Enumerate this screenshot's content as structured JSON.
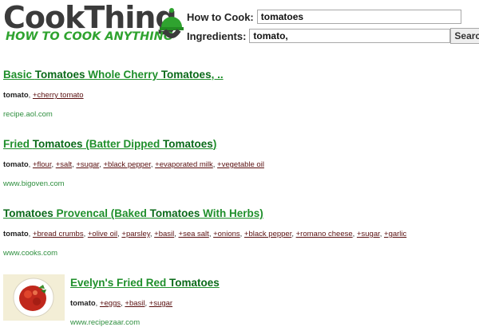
{
  "logo": {
    "name": "CookThing",
    "tagline": "HOW TO COOK ANYTHING"
  },
  "search": {
    "how_to_cook_label": "How to Cook:",
    "how_to_cook_value": "tomatoes",
    "ingredients_label": "Ingredients:",
    "ingredients_value": "tomato,",
    "button_label": "Search"
  },
  "colors": {
    "title_green": "#1f8f2b",
    "logo_green": "#2fa32f",
    "ingredient_link": "#5a1010"
  },
  "results": [
    {
      "title_parts": [
        "Basic ",
        "Tomatoes",
        " Whole Cherry ",
        "Tomatoes",
        ", .."
      ],
      "base": "tomato",
      "ingredients": [
        "+cherry tomato"
      ],
      "source": "recipe.aol.com"
    },
    {
      "title_parts": [
        "Fried ",
        "Tomatoes",
        " (Batter Dipped ",
        "Tomatoes",
        ")"
      ],
      "base": "tomato",
      "ingredients": [
        "+flour",
        "+salt",
        "+sugar",
        "+black pepper",
        "+evaporated milk",
        "+vegetable oil"
      ],
      "source": "www.bigoven.com"
    },
    {
      "title_parts": [
        "Tomatoes",
        " Provencal (Baked ",
        "Tomatoes",
        " With Herbs)"
      ],
      "base": "tomato",
      "ingredients": [
        "+bread crumbs",
        "+olive oil",
        "+parsley",
        "+basil",
        "+sea salt",
        "+onions",
        "+black pepper",
        "+romano cheese",
        "+sugar",
        "+garlic"
      ],
      "source": "www.cooks.com"
    },
    {
      "title_parts": [
        "Evelyn's Fried Red ",
        "Tomatoes"
      ],
      "base": "tomato",
      "ingredients": [
        "+eggs",
        "+basil",
        "+sugar"
      ],
      "source": "www.recipezaar.com",
      "thumbnail": "fried-tomato-plate-image"
    }
  ]
}
